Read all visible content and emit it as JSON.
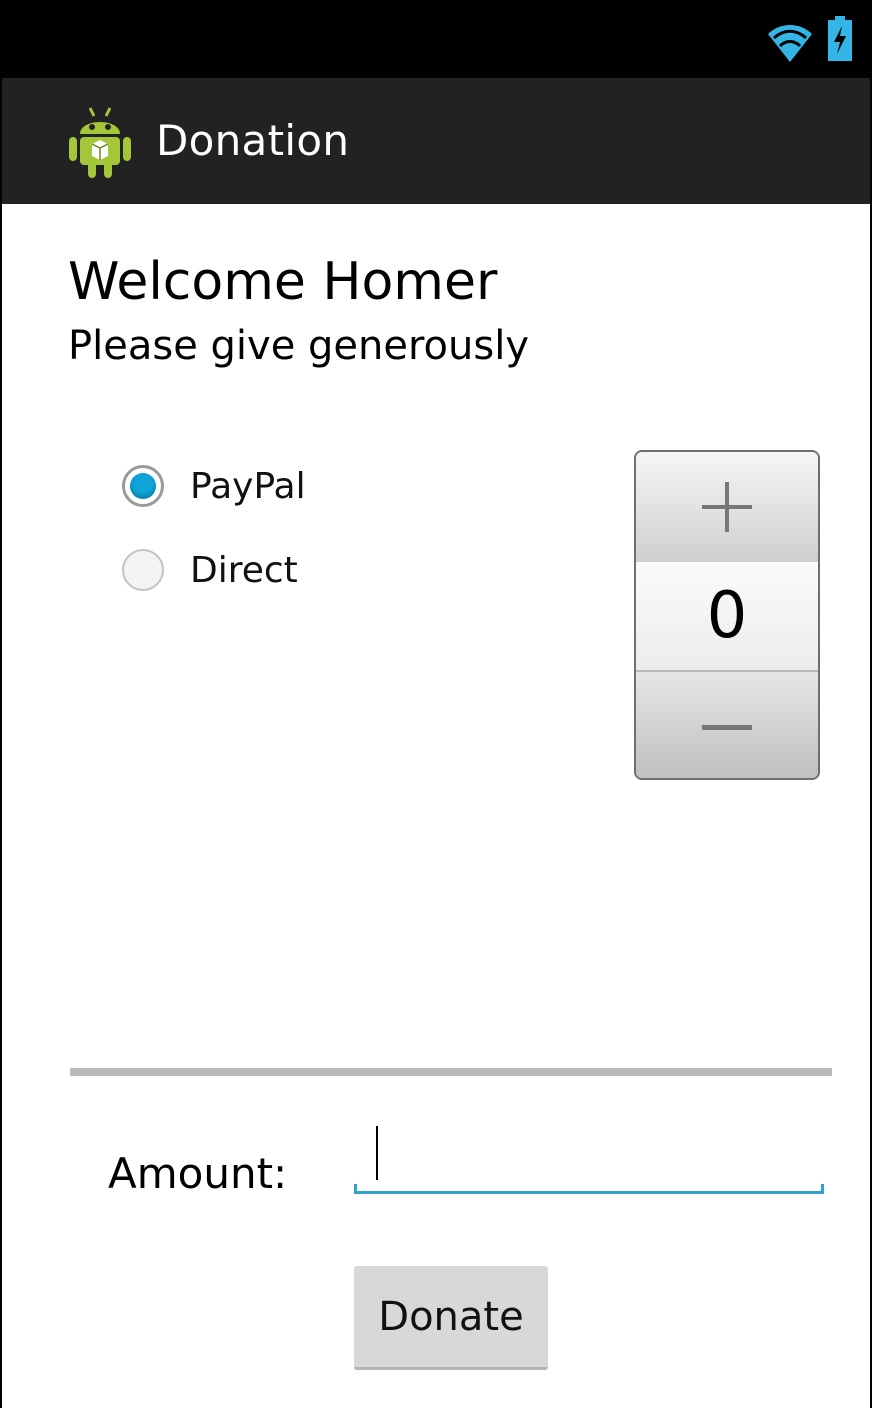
{
  "app": {
    "title": "Donation",
    "icon": "android-robot-icon"
  },
  "status_bar": {
    "icons": [
      "wifi-icon",
      "battery-charging-icon"
    ],
    "accent_color": "#33b5e5"
  },
  "header": {
    "welcome": "Welcome Homer",
    "subtitle": "Please give generously"
  },
  "payment_method": {
    "options": [
      {
        "label": "PayPal",
        "checked": true
      },
      {
        "label": "Direct",
        "checked": false
      }
    ],
    "checked_color": "#0ea5d8"
  },
  "number_picker": {
    "value": "0",
    "increment_icon": "plus-icon",
    "decrement_icon": "minus-icon"
  },
  "amount": {
    "label": "Amount:",
    "value": "",
    "placeholder": ""
  },
  "donate_button": {
    "label": "Donate"
  }
}
